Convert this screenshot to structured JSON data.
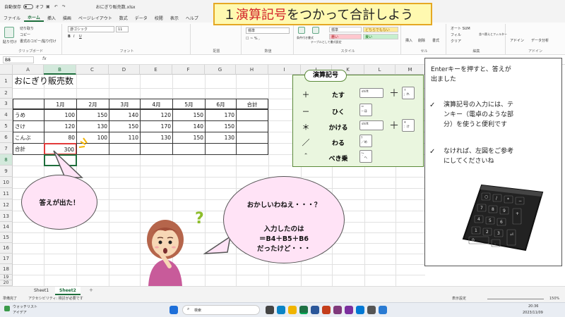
{
  "titlebar": {
    "autosave": "自動保存",
    "toggle_state": "オフ",
    "filename": "おにぎり販売数.xlsx",
    "search_placeholder": "検索"
  },
  "menu_tabs": [
    "ファイル",
    "ホーム",
    "挿入",
    "描画",
    "ページレイアウト",
    "数式",
    "データ",
    "校閲",
    "表示",
    "ヘルプ"
  ],
  "ribbon": {
    "paste": "貼り付け",
    "cut": "切り取り",
    "copy": "コピー",
    "format_painter": "書式のコピー/貼り付け",
    "clipboard": "クリップボード",
    "font_name": "游ゴシック",
    "font_size": "11",
    "font": "フォント",
    "wrap": "折り返して全体を表示する",
    "merge": "セルを結合して中央揃え",
    "alignment": "配置",
    "number_format": "標準",
    "number": "数値",
    "cond_format": "条件付き書式",
    "table_format": "テーブルとして書式設定",
    "style_standard": "標準",
    "style_neutral": "どちらでもない",
    "style_bad": "悪い",
    "style_good": "良い",
    "styles": "スタイル",
    "insert": "挿入",
    "delete": "削除",
    "format": "書式",
    "cells": "セル",
    "autosum": "オート SUM",
    "fill": "フィル",
    "clear": "クリア",
    "sort": "並べ替えとフィルター",
    "find": "検索と選択",
    "editing": "編集",
    "addins": "アドイン",
    "data_analysis": "データ分析",
    "addin_group": "アドイン"
  },
  "formula_bar": {
    "name_box": "B8",
    "fx": "fx"
  },
  "columns": [
    "A",
    "B",
    "C",
    "D",
    "E",
    "F",
    "G",
    "H",
    "I",
    "J",
    "K",
    "L",
    "M"
  ],
  "rows": [
    "1",
    "2",
    "3",
    "4",
    "5",
    "6",
    "7",
    "8",
    "9",
    "10",
    "11",
    "12",
    "13",
    "14",
    "15",
    "16",
    "17",
    "18",
    "19",
    "20"
  ],
  "sheet": {
    "title": "おにぎり販売数",
    "headers": [
      "1月",
      "2月",
      "3月",
      "4月",
      "5月",
      "6月",
      "合計"
    ],
    "items": [
      {
        "name": "うめ",
        "values": [
          "100",
          "150",
          "140",
          "120",
          "150",
          "170"
        ]
      },
      {
        "name": "さけ",
        "values": [
          "120",
          "130",
          "150",
          "170",
          "140",
          "150"
        ]
      },
      {
        "name": "こんぶ",
        "values": [
          "80",
          "100",
          "110",
          "130",
          "150",
          "130"
        ]
      }
    ],
    "total_label": "合計",
    "total_b7": "300"
  },
  "banner": {
    "prefix": "１ ",
    "red": "演算記号",
    "suffix": "をつかって合計しよう"
  },
  "operators": {
    "title": "演算記号",
    "rows": [
      {
        "sym": "＋",
        "word": "たす",
        "key1": "shift",
        "key2": "＋\n；れ"
      },
      {
        "sym": "－",
        "word": "ひく",
        "key1": "",
        "key2": "＝\n－ほ"
      },
      {
        "sym": "＊",
        "word": "かける",
        "key1": "shift",
        "key2": "＊\n：け"
      },
      {
        "sym": "／",
        "word": "わる",
        "key1": "",
        "key2": "？\n／め"
      },
      {
        "sym": "＾",
        "word": "べき乗",
        "key1": "",
        "key2": "～\n＾へ"
      }
    ],
    "plus_sign": "＋"
  },
  "note": {
    "line1": "Enterキーを押すと、答えが",
    "line2": "出ました",
    "check": "✓",
    "tip1_a": "演算記号の入力には、テ",
    "tip1_b": "ンキー（電卓のような部",
    "tip1_c": "分）を使うと便利です",
    "tip2_a": "なければ、左図をご参考",
    "tip2_b": "にしてくださいね"
  },
  "bubble1": "答えが出た！",
  "bubble2": {
    "line1": "おかしいわねえ・・・？",
    "line2": "入力したのは",
    "line3": "＝B4＋B5＋B6",
    "line4": "だったけど・・・"
  },
  "sheet_tabs": [
    "Sheet1",
    "Sheet2"
  ],
  "add_sheet": "＋",
  "status": {
    "ready": "準備完了",
    "accessibility": "アクセシビリティ: 検討が必要です",
    "display_settings": "表示設定",
    "zoom": "150%"
  },
  "taskbar": {
    "weather_title": "ウォッチリスト",
    "weather_sub": "アイデア",
    "search": "検索",
    "time": "20:36",
    "date": "2023/11/09"
  }
}
